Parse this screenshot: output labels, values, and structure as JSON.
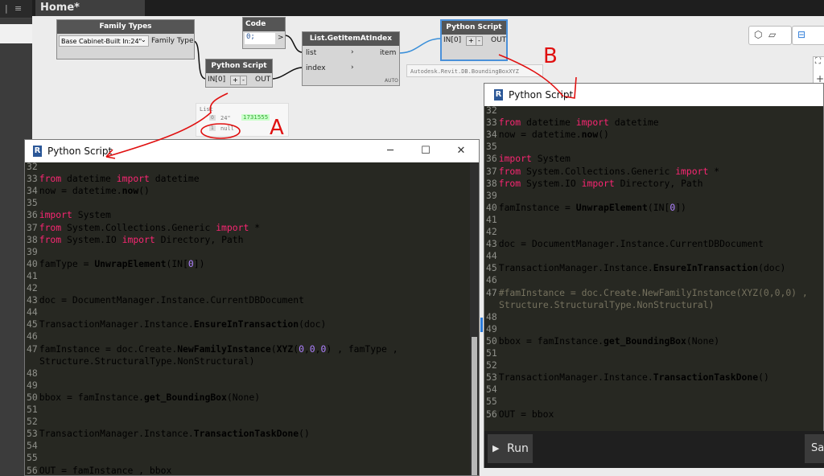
{
  "workspace_tab": "Home*",
  "nodes": {
    "family_types": {
      "title": "Family Types",
      "dropdown": "Base Cabinet-Built In:24\"",
      "output": "Family Type"
    },
    "code_block": {
      "title": "Code Block",
      "code": "0;",
      "port": ">"
    },
    "python_main": {
      "title": "Python Script",
      "input": "IN[0]",
      "plus": "+",
      "minus": "-",
      "output": "OUT"
    },
    "get_item": {
      "title": "List.GetItemAtIndex",
      "in1": "list",
      "in2": "index",
      "out": "item",
      "lacing": "AUTO"
    },
    "python_b": {
      "title": "Python Script",
      "input": "IN[0]",
      "plus": "+",
      "minus": "-",
      "output": "OUT",
      "preview": "Autodesk.Revit.DB.BoundingBoxXYZ"
    }
  },
  "watch": {
    "header": "List",
    "row0_index": "0",
    "row0_value": "24\"",
    "row0_id": "1731555",
    "row1_index": "1",
    "row1_value": "null"
  },
  "annotations": {
    "a": "A",
    "b": "B"
  },
  "editor_left": {
    "title": "Python Script",
    "lines": [
      {
        "n": "32",
        "t": ""
      },
      {
        "n": "33",
        "t": "from datetime import datetime"
      },
      {
        "n": "34",
        "t": "now = datetime.now()"
      },
      {
        "n": "35",
        "t": ""
      },
      {
        "n": "36",
        "t": "import System"
      },
      {
        "n": "37",
        "t": "from System.Collections.Generic import *"
      },
      {
        "n": "38",
        "t": "from System.IO import Directory, Path"
      },
      {
        "n": "39",
        "t": ""
      },
      {
        "n": "40",
        "t": "famType = UnwrapElement(IN[0])"
      },
      {
        "n": "41",
        "t": ""
      },
      {
        "n": "42",
        "t": ""
      },
      {
        "n": "43",
        "t": "doc = DocumentManager.Instance.CurrentDBDocument"
      },
      {
        "n": "44",
        "t": ""
      },
      {
        "n": "45",
        "t": "TransactionManager.Instance.EnsureInTransaction(doc)"
      },
      {
        "n": "46",
        "t": ""
      },
      {
        "n": "47",
        "t": "famInstance = doc.Create.NewFamilyInstance(XYZ(0,0,0) , famType ,"
      },
      {
        "n": "",
        "t": "Structure.StructuralType.NonStructural)"
      },
      {
        "n": "48",
        "t": ""
      },
      {
        "n": "49",
        "t": ""
      },
      {
        "n": "50",
        "t": "bbox = famInstance.get_BoundingBox(None)"
      },
      {
        "n": "51",
        "t": ""
      },
      {
        "n": "52",
        "t": ""
      },
      {
        "n": "53",
        "t": "TransactionManager.Instance.TransactionTaskDone()"
      },
      {
        "n": "54",
        "t": ""
      },
      {
        "n": "55",
        "t": ""
      },
      {
        "n": "56",
        "t": "OUT = famInstance , bbox"
      }
    ]
  },
  "editor_right": {
    "title": "Python Script",
    "run_label": "Run",
    "save_label": "Sa",
    "lines": [
      {
        "n": "32",
        "t": ""
      },
      {
        "n": "33",
        "t": "from datetime import datetime"
      },
      {
        "n": "34",
        "t": "now = datetime.now()"
      },
      {
        "n": "35",
        "t": ""
      },
      {
        "n": "36",
        "t": "import System"
      },
      {
        "n": "37",
        "t": "from System.Collections.Generic import *"
      },
      {
        "n": "38",
        "t": "from System.IO import Directory, Path"
      },
      {
        "n": "39",
        "t": ""
      },
      {
        "n": "40",
        "t": "famInstance = UnwrapElement(IN[0])"
      },
      {
        "n": "41",
        "t": ""
      },
      {
        "n": "42",
        "t": ""
      },
      {
        "n": "43",
        "t": "doc = DocumentManager.Instance.CurrentDBDocument"
      },
      {
        "n": "44",
        "t": ""
      },
      {
        "n": "45",
        "t": "TransactionManager.Instance.EnsureInTransaction(doc)"
      },
      {
        "n": "46",
        "t": ""
      },
      {
        "n": "47",
        "t": "#famInstance = doc.Create.NewFamilyInstance(XYZ(0,0,0) ,"
      },
      {
        "n": "",
        "t": "Structure.StructuralType.NonStructural)"
      },
      {
        "n": "48",
        "t": ""
      },
      {
        "n": "49",
        "t": ""
      },
      {
        "n": "50",
        "t": "bbox = famInstance.get_BoundingBox(None)"
      },
      {
        "n": "51",
        "t": ""
      },
      {
        "n": "52",
        "t": ""
      },
      {
        "n": "53",
        "t": "TransactionManager.Instance.TransactionTaskDone()"
      },
      {
        "n": "54",
        "t": ""
      },
      {
        "n": "55",
        "t": ""
      },
      {
        "n": "56",
        "t": "OUT = bbox"
      }
    ]
  },
  "colors": {
    "keyword": "#f92672",
    "number": "#ae81ff",
    "comment": "#75715e",
    "text": "#f8f8f2",
    "annotation": "#e01010",
    "selected_node": "#4a90d9"
  }
}
